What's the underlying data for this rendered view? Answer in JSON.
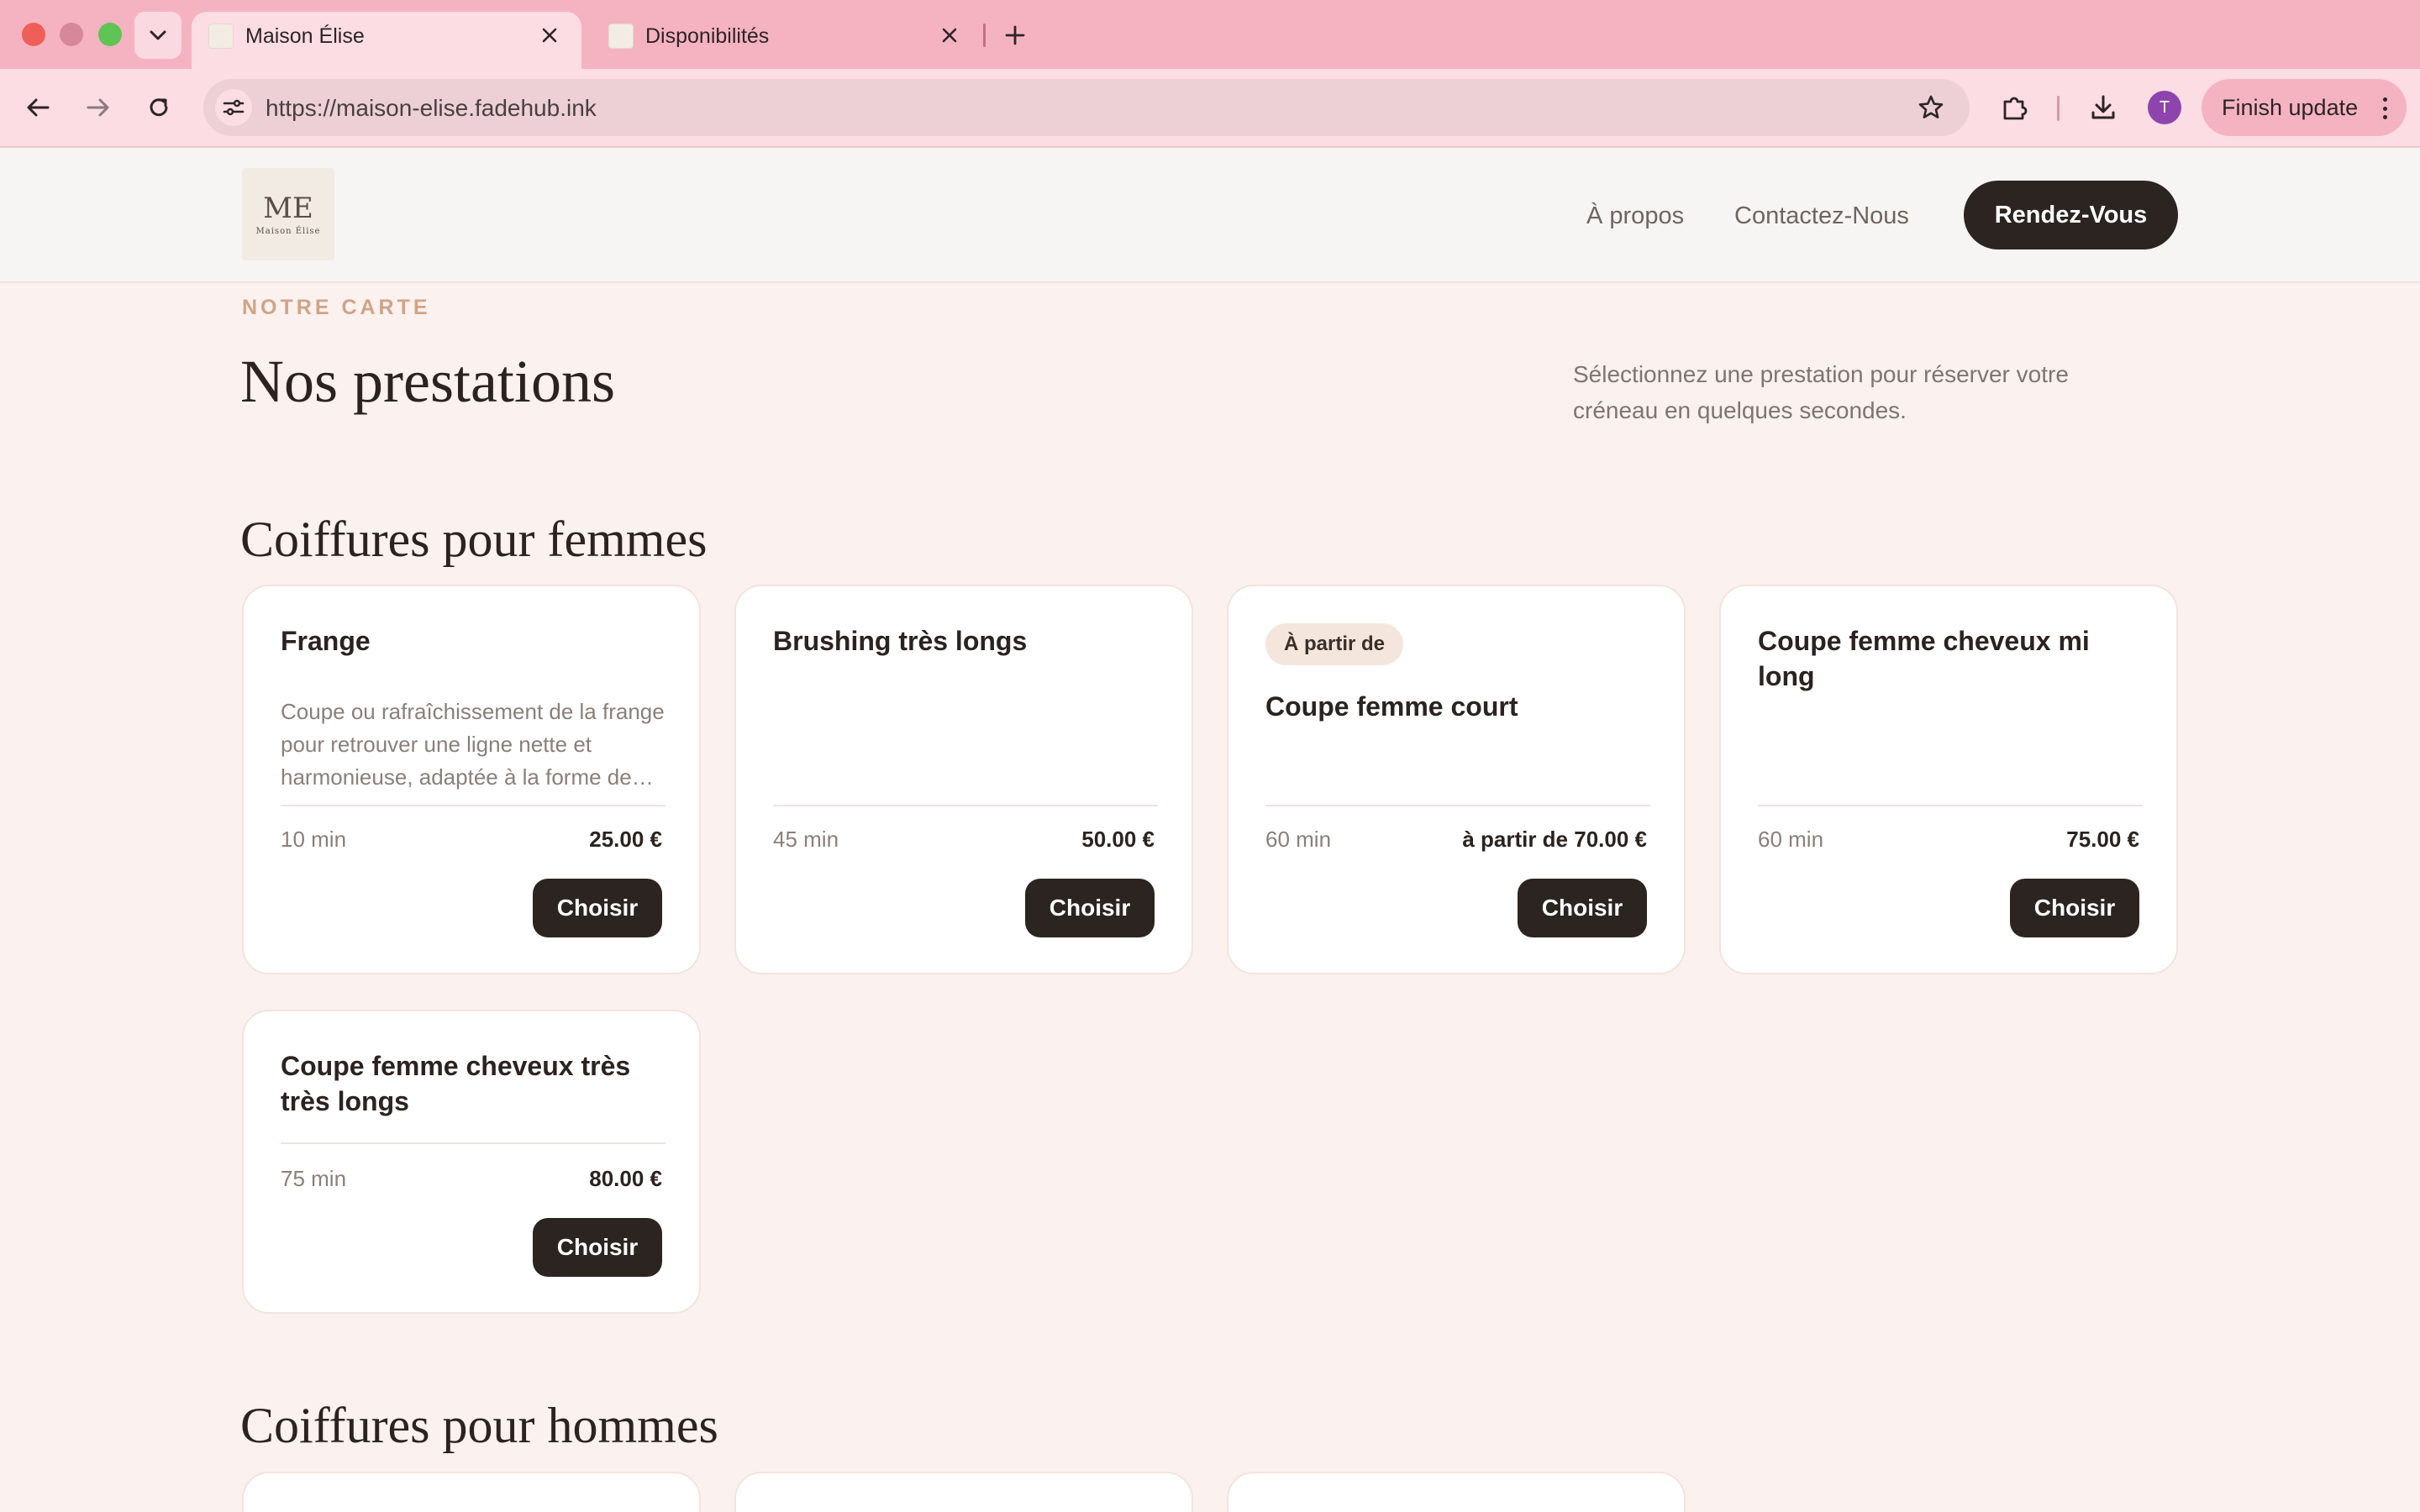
{
  "browser": {
    "tabs": [
      {
        "title": "Maison Élise",
        "active": true
      },
      {
        "title": "Disponibilités",
        "active": false
      }
    ],
    "url": "https://maison-elise.fadehub.ink",
    "profile_initial": "T",
    "finish_update": "Finish update",
    "accent": "#f5b3c1"
  },
  "header": {
    "logo_mono": "ME",
    "logo_brand": "Maison Élise",
    "nav": [
      "À propos",
      "Contactez-Nous"
    ],
    "cta": "Rendez-Vous"
  },
  "page": {
    "eyebrow": "NOTRE CARTE",
    "title": "Nos prestations",
    "intro": "Sélectionnez une prestation pour réserver votre créneau en quelques secondes."
  },
  "sections": [
    {
      "title": "Coiffures pour femmes",
      "services": [
        {
          "name": "Frange",
          "description": "Coupe ou rafraîchissement de la frange pour retrouver une ligne nette et harmonieuse, adaptée à la forme de…",
          "duration": "10 min",
          "price": "25.00 €",
          "button": "Choisir"
        },
        {
          "name": "Brushing très longs",
          "duration": "45 min",
          "price": "50.00 €",
          "button": "Choisir"
        },
        {
          "badge": "À partir de",
          "name": "Coupe femme court",
          "duration": "60 min",
          "price": "à partir de 70.00 €",
          "button": "Choisir"
        },
        {
          "name": "Coupe femme cheveux mi long",
          "duration": "60 min",
          "price": "75.00 €",
          "button": "Choisir"
        },
        {
          "name": "Coupe femme cheveux très très longs",
          "duration": "75 min",
          "price": "80.00 €",
          "button": "Choisir"
        }
      ]
    },
    {
      "title": "Coiffures pour hommes"
    }
  ]
}
